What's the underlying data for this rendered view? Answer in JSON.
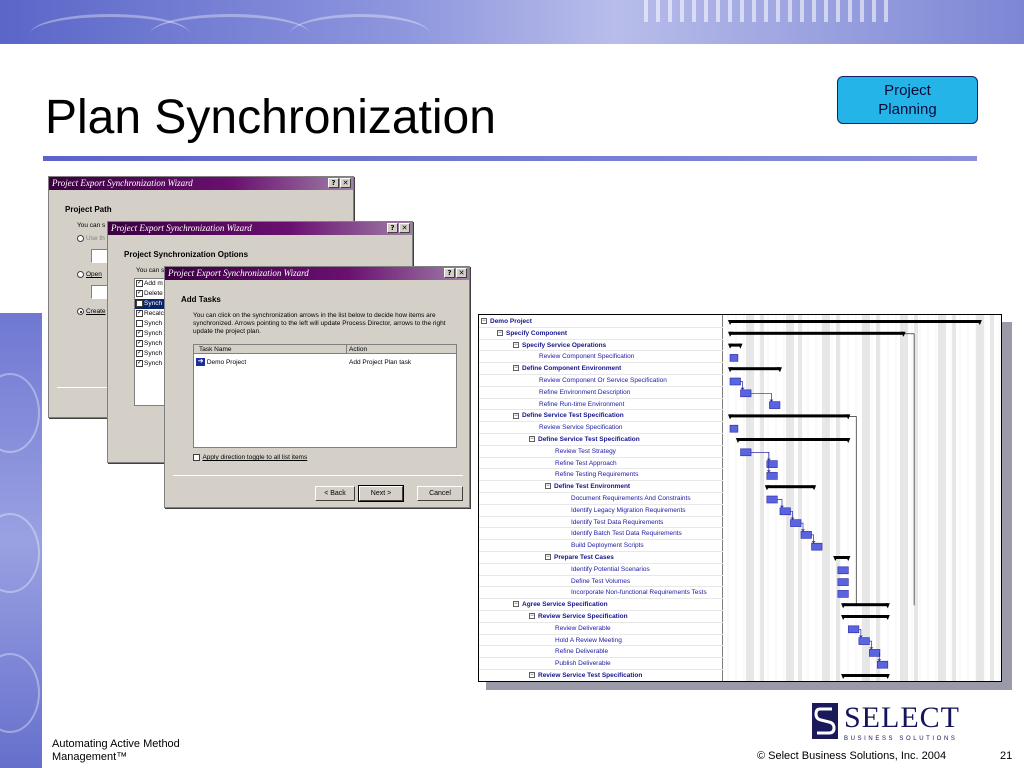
{
  "slide": {
    "title": "Plan Synchronization",
    "badge": "Project\nPlanning",
    "footer_left": "Automating Active Method\nManagement™",
    "copyright": "© Select Business Solutions, Inc. 2004",
    "page_number": "21",
    "logo_word": "SELECT",
    "logo_sub": "BUSINESS SOLUTIONS"
  },
  "dialog1": {
    "title": "Project Export Synchronization Wizard",
    "help": "?",
    "close": "✕",
    "heading": "Project Path",
    "text1": "You can s",
    "opt1": "Use th",
    "opt2": "Open",
    "opt3": "Create"
  },
  "dialog2": {
    "title": "Project Export Synchronization Wizard",
    "help": "?",
    "close": "✕",
    "heading": "Project Synchronization Options",
    "text1": "You can s",
    "items": [
      {
        "label": "Add m",
        "checked": true,
        "selected": false
      },
      {
        "label": "Delete",
        "checked": true,
        "selected": false
      },
      {
        "label": "Synch",
        "checked": false,
        "selected": true
      },
      {
        "label": "Recalc",
        "checked": true,
        "selected": false
      },
      {
        "label": "Synch",
        "checked": false,
        "selected": false
      },
      {
        "label": "Synch",
        "checked": true,
        "selected": false
      },
      {
        "label": "Synch",
        "checked": true,
        "selected": false
      },
      {
        "label": "Synch",
        "checked": true,
        "selected": false
      },
      {
        "label": "Synch",
        "checked": true,
        "selected": false
      }
    ]
  },
  "dialog3": {
    "title": "Project Export Synchronization Wizard",
    "help": "?",
    "close": "✕",
    "heading": "Add Tasks",
    "instructions": "You can click on the synchronization arrows in the list below to decide how items are synchronized.  Arrows pointing to the left will update Process Director, arrows to the right update the project plan.",
    "col_task": "Task Name",
    "col_action": "Action",
    "row_task": "Demo Project",
    "row_action": "Add Project Plan task",
    "toggle_label": "Apply direction toggle to all list items",
    "back": "< Back",
    "next": "Next >",
    "cancel": "Cancel"
  },
  "gantt": {
    "rows": [
      {
        "label": "Demo Project",
        "indent": 0,
        "bold": true,
        "toggle": "−"
      },
      {
        "label": "Specify Component",
        "indent": 1,
        "bold": true,
        "toggle": "−"
      },
      {
        "label": "Specify Service Operations",
        "indent": 2,
        "bold": true,
        "toggle": "−"
      },
      {
        "label": "Review Component Specification",
        "indent": 3,
        "bold": false,
        "toggle": ""
      },
      {
        "label": "Define Component Environment",
        "indent": 2,
        "bold": true,
        "toggle": "−"
      },
      {
        "label": "Review Component Or Service Specification",
        "indent": 3,
        "bold": false,
        "toggle": ""
      },
      {
        "label": "Refine Environment Description",
        "indent": 3,
        "bold": false,
        "toggle": ""
      },
      {
        "label": "Refine Run-time Environment",
        "indent": 3,
        "bold": false,
        "toggle": ""
      },
      {
        "label": "Define Service Test Specification",
        "indent": 2,
        "bold": true,
        "toggle": "−"
      },
      {
        "label": "Review Service Specification",
        "indent": 3,
        "bold": false,
        "toggle": ""
      },
      {
        "label": "Define Service Test Specification",
        "indent": 3,
        "bold": true,
        "toggle": "−"
      },
      {
        "label": "Review Test Strategy",
        "indent": 4,
        "bold": false,
        "toggle": ""
      },
      {
        "label": "Refine Test Approach",
        "indent": 4,
        "bold": false,
        "toggle": ""
      },
      {
        "label": "Refine Testing Requirements",
        "indent": 4,
        "bold": false,
        "toggle": ""
      },
      {
        "label": "Define Test Environment",
        "indent": 4,
        "bold": true,
        "toggle": "−"
      },
      {
        "label": "Document Requirements And Constraints",
        "indent": 5,
        "bold": false,
        "toggle": ""
      },
      {
        "label": "Identify Legacy Migration Requirements",
        "indent": 5,
        "bold": false,
        "toggle": ""
      },
      {
        "label": "Identify Test Data Requirements",
        "indent": 5,
        "bold": false,
        "toggle": ""
      },
      {
        "label": "Identify Batch Test Data Requirements",
        "indent": 5,
        "bold": false,
        "toggle": ""
      },
      {
        "label": "Build Deployment Scripts",
        "indent": 5,
        "bold": false,
        "toggle": ""
      },
      {
        "label": "Prepare Test Cases",
        "indent": 4,
        "bold": true,
        "toggle": "−"
      },
      {
        "label": "Identify Potential Scenarios",
        "indent": 5,
        "bold": false,
        "toggle": ""
      },
      {
        "label": "Define Test Volumes",
        "indent": 5,
        "bold": false,
        "toggle": ""
      },
      {
        "label": "Incorporate Non-functional Requirements Tests",
        "indent": 5,
        "bold": false,
        "toggle": ""
      },
      {
        "label": "Agree Service Specification",
        "indent": 2,
        "bold": true,
        "toggle": "−"
      },
      {
        "label": "Review Service Specification",
        "indent": 3,
        "bold": true,
        "toggle": "−"
      },
      {
        "label": "Review Deliverable",
        "indent": 4,
        "bold": false,
        "toggle": ""
      },
      {
        "label": "Hold A Review Meeting",
        "indent": 4,
        "bold": false,
        "toggle": ""
      },
      {
        "label": "Refine Deliverable",
        "indent": 4,
        "bold": false,
        "toggle": ""
      },
      {
        "label": "Publish Deliverable",
        "indent": 4,
        "bold": false,
        "toggle": ""
      },
      {
        "label": "Review Service Test Specification",
        "indent": 3,
        "bold": true,
        "toggle": "−"
      }
    ],
    "bars": [
      {
        "type": "summary",
        "start": 0,
        "end": 95
      },
      {
        "type": "summary",
        "start": 0,
        "end": 66
      },
      {
        "type": "summary",
        "start": 0,
        "end": 4
      },
      {
        "type": "task",
        "start": 0,
        "end": 3
      },
      {
        "type": "summary",
        "start": 0,
        "end": 19
      },
      {
        "type": "task",
        "start": 0,
        "end": 4
      },
      {
        "type": "task",
        "start": 4,
        "end": 8
      },
      {
        "type": "task",
        "start": 15,
        "end": 19
      },
      {
        "type": "summary",
        "start": 0,
        "end": 45
      },
      {
        "type": "task",
        "start": 0,
        "end": 3
      },
      {
        "type": "summary",
        "start": 3,
        "end": 45
      },
      {
        "type": "task",
        "start": 4,
        "end": 8
      },
      {
        "type": "task",
        "start": 14,
        "end": 18
      },
      {
        "type": "task",
        "start": 14,
        "end": 18
      },
      {
        "type": "summary",
        "start": 14,
        "end": 32
      },
      {
        "type": "task",
        "start": 14,
        "end": 18
      },
      {
        "type": "task",
        "start": 19,
        "end": 23
      },
      {
        "type": "task",
        "start": 23,
        "end": 27
      },
      {
        "type": "task",
        "start": 27,
        "end": 31
      },
      {
        "type": "task",
        "start": 31,
        "end": 35
      },
      {
        "type": "summary",
        "start": 40,
        "end": 45
      },
      {
        "type": "task",
        "start": 41,
        "end": 45
      },
      {
        "type": "task",
        "start": 41,
        "end": 45
      },
      {
        "type": "task",
        "start": 41,
        "end": 45
      },
      {
        "type": "summary",
        "start": 43,
        "end": 60
      },
      {
        "type": "summary",
        "start": 43,
        "end": 60
      },
      {
        "type": "task",
        "start": 45,
        "end": 49
      },
      {
        "type": "task",
        "start": 49,
        "end": 53
      },
      {
        "type": "task",
        "start": 53,
        "end": 57
      },
      {
        "type": "task",
        "start": 56,
        "end": 60
      },
      {
        "type": "summary",
        "start": 43,
        "end": 60
      }
    ]
  }
}
